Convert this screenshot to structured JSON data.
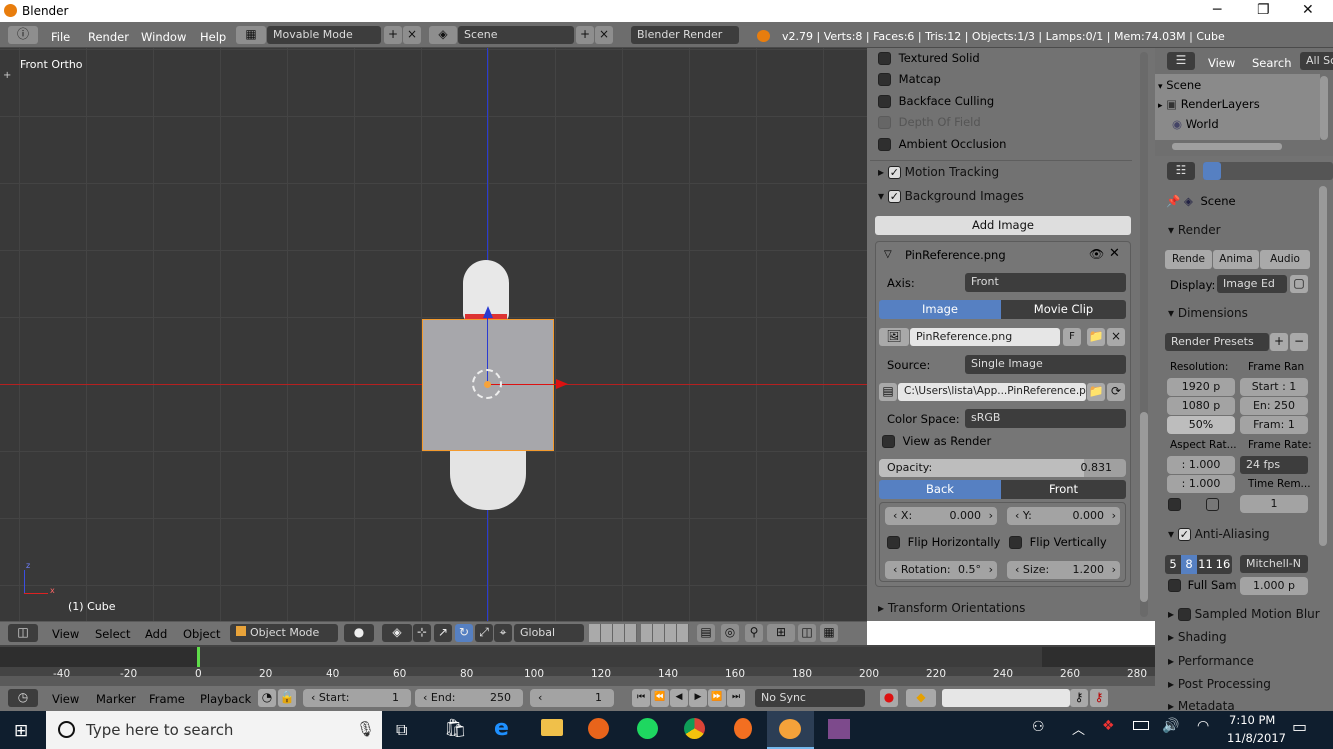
{
  "window": {
    "title": "Blender",
    "minimize": "─",
    "maximize": "❐",
    "close": "✕"
  },
  "top_menu": {
    "items": [
      "File",
      "Render",
      "Window",
      "Help"
    ],
    "layout": "Movable Mode",
    "scene": "Scene",
    "engine": "Blender Render",
    "stats": "v2.79 | Verts:8 | Faces:6 | Tris:12 | Objects:1/3 | Lamps:0/1 | Mem:74.03M | Cube"
  },
  "viewport": {
    "view_label": "Front Ortho",
    "object_label": "(1) Cube",
    "axis_z": "z",
    "axis_x": "x"
  },
  "display_panel": {
    "items": [
      {
        "label": "Textured Solid",
        "enabled": true
      },
      {
        "label": "Matcap",
        "enabled": true
      },
      {
        "label": "Backface Culling",
        "enabled": true
      },
      {
        "label": "Depth Of Field",
        "enabled": false
      },
      {
        "label": "Ambient Occlusion",
        "enabled": true
      }
    ]
  },
  "motion_tracking": {
    "label": "Motion Tracking"
  },
  "background_images": {
    "label": "Background Images",
    "add_image": "Add Image",
    "image_name": "PinReference.png",
    "axis_label": "Axis:",
    "axis_value": "Front",
    "source_tabs": [
      "Image",
      "Movie Clip"
    ],
    "file_field": "PinReference.png",
    "file_flag": "F",
    "source_label": "Source:",
    "source_value": "Single Image",
    "path": "C:\\Users\\lista\\App...PinReference.png",
    "color_space_label": "Color Space:",
    "color_space_value": "sRGB",
    "view_as_render": "View as Render",
    "opacity_label": "Opacity:",
    "opacity_value": "0.831",
    "opacity_fraction": 0.831,
    "depth_tabs": [
      "Back",
      "Front"
    ],
    "x_label": "X:",
    "x_value": "0.000",
    "y_label": "Y:",
    "y_value": "0.000",
    "flip_h": "Flip Horizontally",
    "flip_v": "Flip Vertically",
    "rotation_label": "Rotation:",
    "rotation_value": "0.5°",
    "size_label": "Size:",
    "size_value": "1.200"
  },
  "transform_orientations": {
    "label": "Transform Orientations"
  },
  "outliner": {
    "view": "View",
    "search": "Search",
    "all_scenes": "All Sc",
    "items": [
      "Scene",
      "RenderLayers",
      "World"
    ]
  },
  "properties": {
    "scene": "Scene",
    "render": "Render",
    "render_buttons": [
      "Rende",
      "Anima",
      "Audio"
    ],
    "display_label": "Display:",
    "display_value": "Image Ed",
    "dimensions": "Dimensions",
    "render_presets": "Render Presets",
    "resolution_label": "Resolution:",
    "res_x": "1920 p",
    "res_y": "1080 p",
    "res_pct": "50%",
    "frame_range_label": "Frame Ran",
    "frame_start": "Start : 1",
    "frame_end": "En: 250",
    "frame_step": "Fram: 1",
    "aspect_label": "Aspect Rat...",
    "aspect_x": ": 1.000",
    "aspect_y": ": 1.000",
    "frame_rate_label": "Frame Rate:",
    "frame_rate": "24 fps",
    "time_rem": "Time Rem...",
    "time_val": "1",
    "anti_aliasing": "Anti-Aliasing",
    "aa_samples": [
      "5",
      "8",
      "11",
      "16"
    ],
    "aa_filter": "Mitchell-N",
    "full_sample": "Full Sam",
    "filter_size": "1.000 p",
    "sections": [
      "Sampled Motion Blur",
      "Shading",
      "Performance",
      "Post Processing",
      "Metadata"
    ]
  },
  "viewport_header": {
    "menus": [
      "View",
      "Select",
      "Add",
      "Object"
    ],
    "mode": "Object Mode",
    "orientation": "Global"
  },
  "timeline": {
    "ticks": [
      "-40",
      "-20",
      "0",
      "20",
      "40",
      "60",
      "80",
      "100",
      "120",
      "140",
      "160",
      "180",
      "200",
      "220",
      "240",
      "260",
      "280"
    ],
    "menus": [
      "View",
      "Marker",
      "Frame",
      "Playback"
    ],
    "start_label": "Start:",
    "start_value": "1",
    "end_label": "End:",
    "end_value": "250",
    "current": "1",
    "sync": "No Sync"
  },
  "taskbar": {
    "search_placeholder": "Type here to search",
    "time": "7:10 PM",
    "date": "11/8/2017"
  }
}
